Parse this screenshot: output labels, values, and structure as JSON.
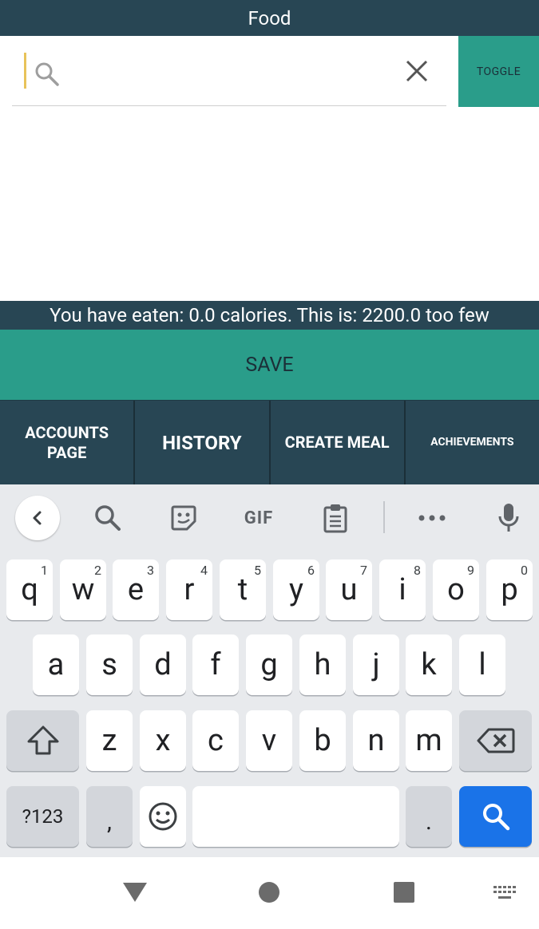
{
  "app": {
    "title": "Food"
  },
  "search": {
    "placeholder": "",
    "value": "",
    "toggle_label": "TOGGLE"
  },
  "status": {
    "calories_text": "You have eaten: 0.0 calories. This is: 2200.0 too few"
  },
  "actions": {
    "save_label": "SAVE"
  },
  "nav": {
    "items": [
      {
        "label": "ACCOUNTS\nPAGE"
      },
      {
        "label": "HISTORY"
      },
      {
        "label": "CREATE MEAL"
      },
      {
        "label": "ACHIEVEMENTS"
      }
    ]
  },
  "keyboard": {
    "toolbar": {
      "gif_label": "GIF"
    },
    "row1": [
      {
        "key": "q",
        "hint": "1"
      },
      {
        "key": "w",
        "hint": "2"
      },
      {
        "key": "e",
        "hint": "3"
      },
      {
        "key": "r",
        "hint": "4"
      },
      {
        "key": "t",
        "hint": "5"
      },
      {
        "key": "y",
        "hint": "6"
      },
      {
        "key": "u",
        "hint": "7"
      },
      {
        "key": "i",
        "hint": "8"
      },
      {
        "key": "o",
        "hint": "9"
      },
      {
        "key": "p",
        "hint": "0"
      }
    ],
    "row2": [
      "a",
      "s",
      "d",
      "f",
      "g",
      "h",
      "j",
      "k",
      "l"
    ],
    "row3": [
      "z",
      "x",
      "c",
      "v",
      "b",
      "n",
      "m"
    ],
    "row4": {
      "symbols_label": "?123",
      "comma": ",",
      "period": "."
    }
  },
  "colors": {
    "header": "#284654",
    "accent": "#2a9d8a",
    "keyboard_bg": "#e8eaed",
    "search_key": "#1a73e8"
  }
}
